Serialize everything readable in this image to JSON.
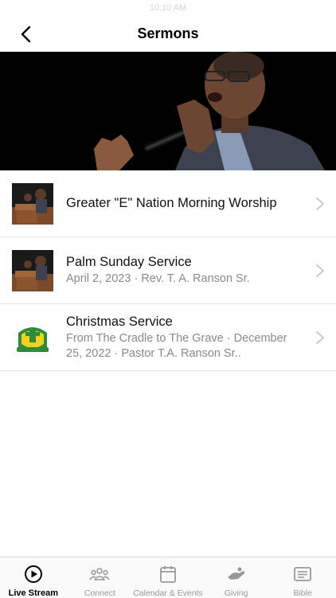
{
  "status_bar": {
    "time": "10:10 AM"
  },
  "header": {
    "title": "Sermons"
  },
  "sermons": [
    {
      "title": "Greater \"E\" Nation Morning Worship",
      "subtitle": ""
    },
    {
      "title": "Palm Sunday Service",
      "subtitle": "April 2, 2023 · Rev. T. A. Ranson Sr."
    },
    {
      "title": "Christmas Service",
      "subtitle": "From The Cradle to The Grave · December 25, 2022 · Pastor T.A. Ranson Sr.."
    }
  ],
  "tabs": [
    {
      "label": "Live Stream",
      "icon": "play-circle-icon",
      "active": true
    },
    {
      "label": "Connect",
      "icon": "people-icon",
      "active": false
    },
    {
      "label": "Calendar & Events",
      "icon": "calendar-icon",
      "active": false
    },
    {
      "label": "Giving",
      "icon": "giving-hand-icon",
      "active": false
    },
    {
      "label": "Bible",
      "icon": "bible-icon",
      "active": false
    }
  ],
  "colors": {
    "accent": "#000000",
    "inactive": "#999999",
    "separator": "#e6e6e6"
  }
}
